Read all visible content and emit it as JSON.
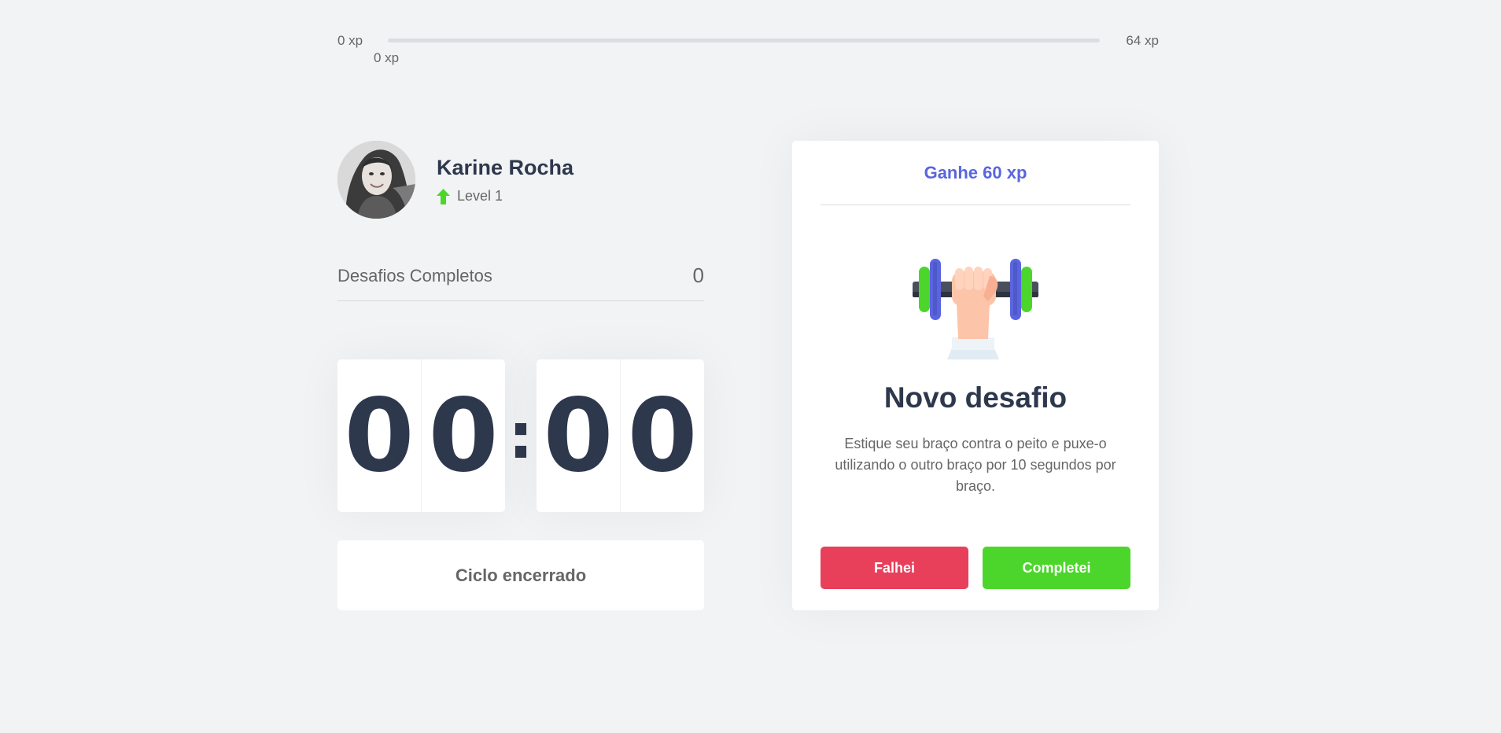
{
  "experience": {
    "min_label": "0 xp",
    "max_label": "64 xp",
    "current_label": "0 xp",
    "progress_fraction": 0
  },
  "profile": {
    "name": "Karine Rocha",
    "level_label": "Level 1",
    "level_icon": "level-up-arrow-icon"
  },
  "completed_challenges": {
    "label": "Desafios Completos",
    "value": "0"
  },
  "countdown": {
    "minute_left": "0",
    "minute_right": "0",
    "separator": ":",
    "second_left": "0",
    "second_right": "0"
  },
  "cycle_button": {
    "label": "Ciclo encerrado"
  },
  "challenge": {
    "header": "Ganhe 60 xp",
    "icon": "dumbbell-body-icon",
    "title": "Novo desafio",
    "description": "Estique seu braço contra o peito e puxe-o utilizando o outro braço por 10 segundos por braço.",
    "failed_label": "Falhei",
    "succeeded_label": "Completei"
  },
  "colors": {
    "background": "#f2f3f5",
    "title": "#2e384d",
    "text": "#666666",
    "blue": "#5965e0",
    "red": "#e83f5b",
    "green": "#4cd62b"
  }
}
